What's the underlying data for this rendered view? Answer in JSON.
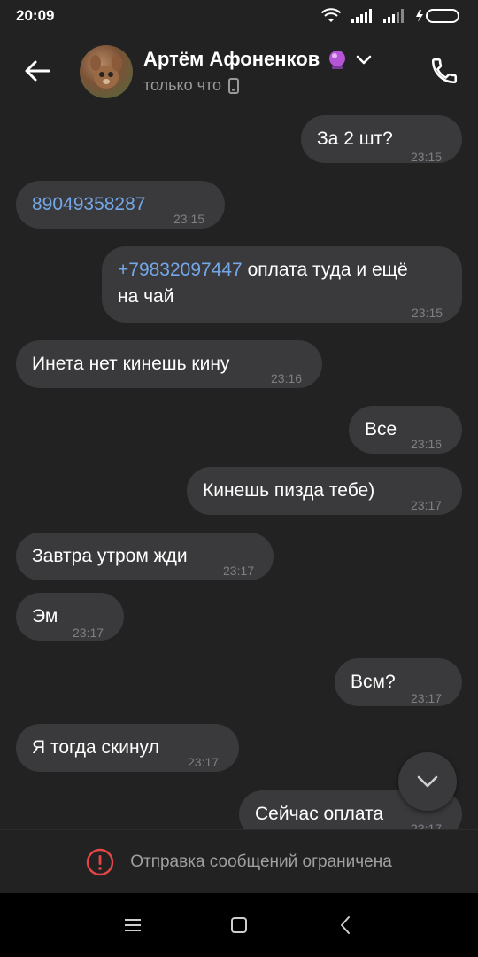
{
  "status_bar": {
    "time": "20:09"
  },
  "header": {
    "contact_name": "Артём Афоненков",
    "presence": "только что"
  },
  "messages": [
    {
      "dir": "out",
      "text": "За 2 шт?",
      "time": "23:15"
    },
    {
      "dir": "in",
      "link": "89049358287",
      "time": "23:15"
    },
    {
      "dir": "out",
      "link": "+79832097447",
      "text": " оплата туда и ещё",
      "text2": "на чай",
      "time": "23:15"
    },
    {
      "dir": "in",
      "text": "Инета нет кинешь кину",
      "time": "23:16"
    },
    {
      "dir": "out",
      "text": "Все",
      "time": "23:16"
    },
    {
      "dir": "out",
      "text": "Кинешь пизда тебе)",
      "time": "23:17"
    },
    {
      "dir": "in",
      "text": "Завтра утром жди",
      "time": "23:17"
    },
    {
      "dir": "in",
      "text": "Эм",
      "time": "23:17"
    },
    {
      "dir": "out",
      "text": "Всм?",
      "time": "23:17"
    },
    {
      "dir": "in",
      "text": "Я тогда скинул",
      "time": "23:17"
    },
    {
      "dir": "out",
      "text": "Сейчас оплата",
      "time": "23:17"
    }
  ],
  "bottom_bar": {
    "notice": "Отправка сообщений ограничена"
  },
  "colors": {
    "background": "#222222",
    "bubble": "#3a3a3c",
    "link": "#74a7e8",
    "error": "#e64646"
  }
}
